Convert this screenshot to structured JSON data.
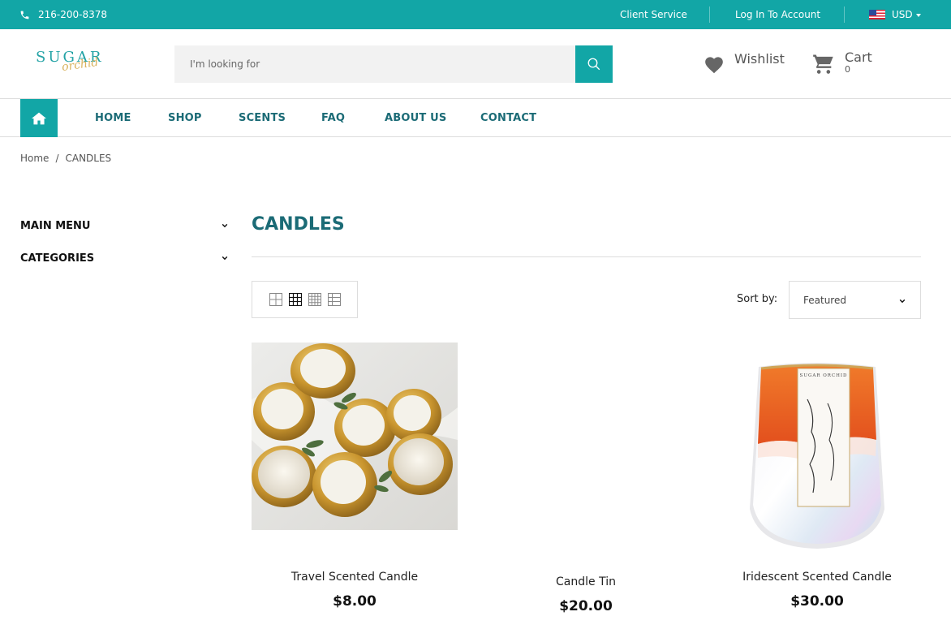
{
  "topbar": {
    "phone": "216-200-8378",
    "client_service": "Client Service",
    "login": "Log In To Account",
    "currency": "USD"
  },
  "logo": {
    "line1": "SUGAR",
    "line2": "orchid"
  },
  "search": {
    "placeholder": "I'm looking for"
  },
  "header": {
    "wishlist": "Wishlist",
    "cart": "Cart",
    "cart_count": "0"
  },
  "nav": {
    "items": [
      "HOME",
      "SHOP",
      "SCENTS",
      "FAQ",
      "ABOUT US",
      "CONTACT"
    ]
  },
  "breadcrumb": {
    "home": "Home",
    "sep": "/",
    "current": "CANDLES"
  },
  "sidebar": {
    "items": [
      "MAIN MENU",
      "CATEGORIES"
    ]
  },
  "page": {
    "title": "CANDLES"
  },
  "sort": {
    "label": "Sort by:",
    "value": "Featured"
  },
  "products": [
    {
      "name": "Travel Scented Candle",
      "price": "$8.00"
    },
    {
      "name": "Candle Tin",
      "price": "$20.00"
    },
    {
      "name": "Iridescent Scented Candle",
      "price": "$30.00"
    }
  ],
  "colors": {
    "accent": "#12a6a6",
    "heading": "#1b6b76"
  }
}
